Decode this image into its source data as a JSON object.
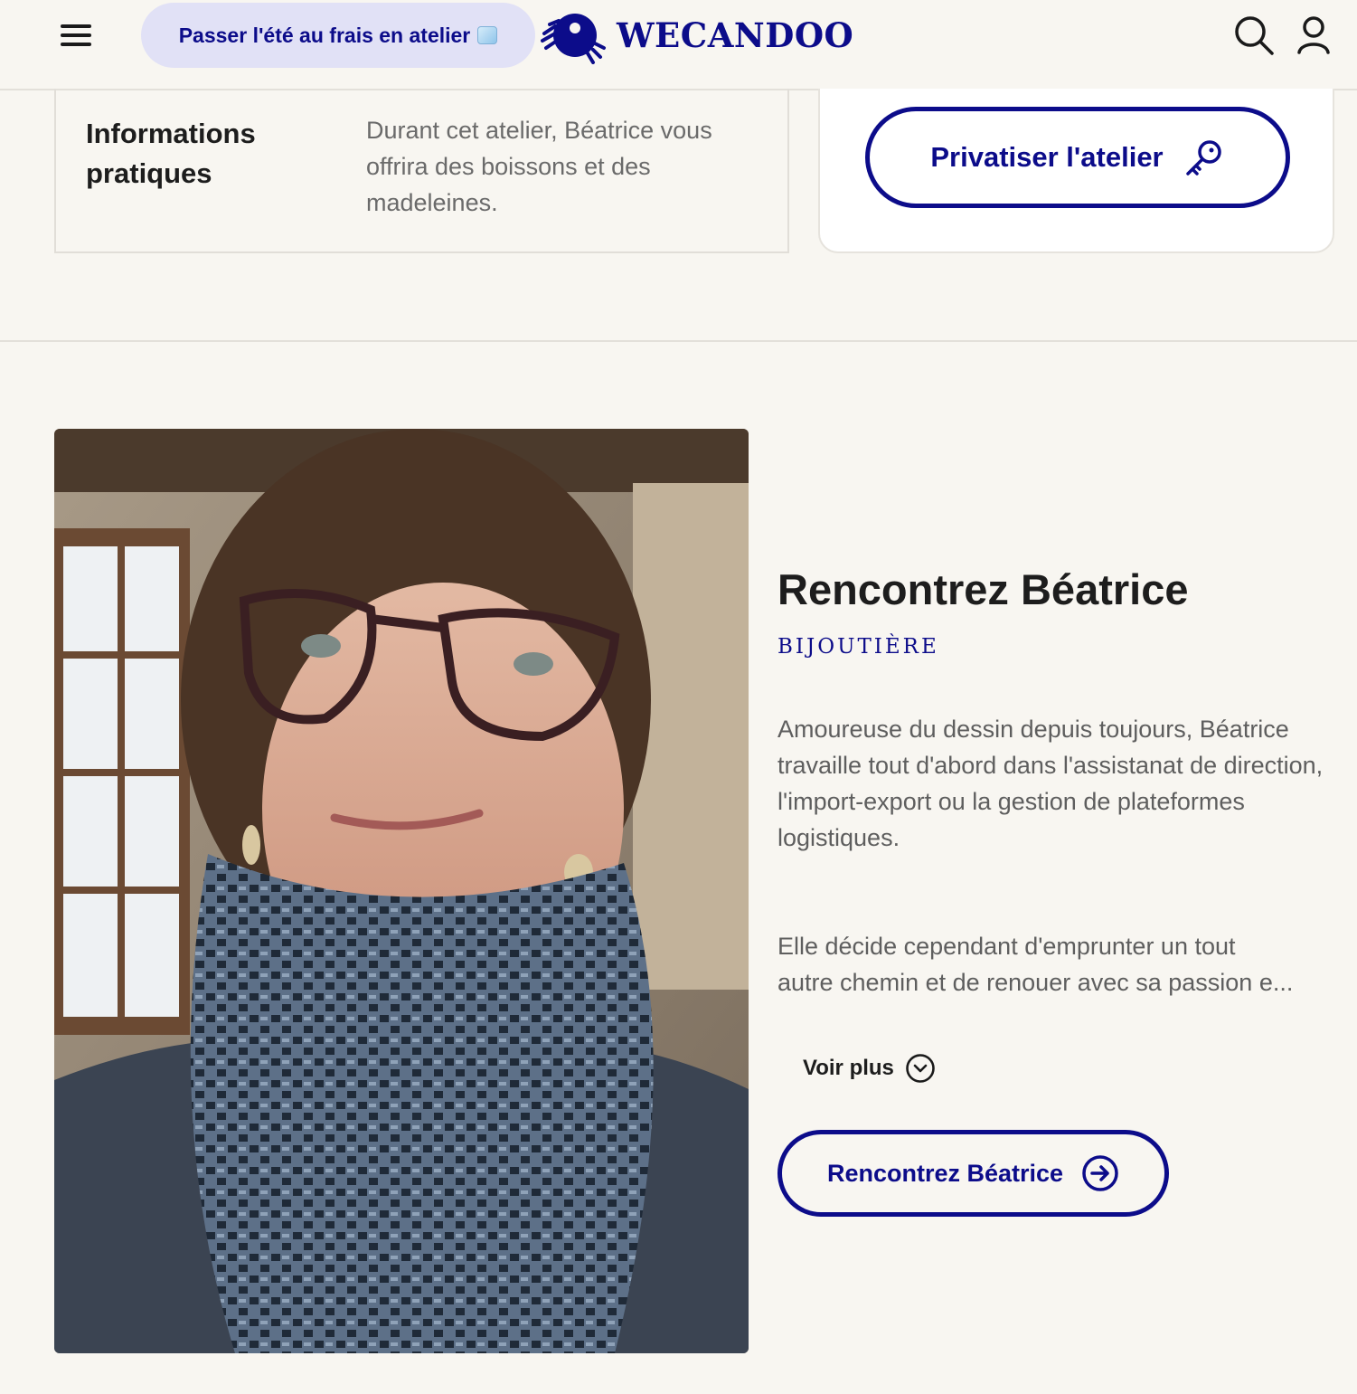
{
  "header": {
    "menu_icon": "hamburger-menu-icon",
    "promo_label": "Passer l'été au frais en atelier",
    "promo_icon": "ice-cube-icon",
    "logo_text": "WECANDOO",
    "search_icon": "search-icon",
    "account_icon": "user-icon",
    "brand_color": "#0c0c8a"
  },
  "info": {
    "title": "Informations pratiques",
    "text": "Durant cet atelier, Béatrice vous offrira des boissons et des madeleines."
  },
  "privatize": {
    "label": "Privatiser l'atelier",
    "icon": "key-icon"
  },
  "artisan": {
    "photo_icon": "artisan-portrait-photo",
    "name_heading": "Rencontrez Béatrice",
    "role": "BIJOUTIÈRE",
    "bio_paragraph_1": "Amoureuse du dessin depuis toujours, Béatrice travaille tout d'abord dans l'assistanat de direction, l'import-export ou la gestion de plateformes logistiques.",
    "bio_paragraph_2_line1": "Elle décide cependant d'emprunter un tout",
    "bio_paragraph_2_line2": "autre chemin et de renouer avec sa passion e...",
    "voir_plus_label": "Voir plus",
    "voir_plus_icon": "chevron-down-circle-icon",
    "meet_button_label": "Rencontrez Béatrice",
    "meet_button_icon": "arrow-right-circle-icon"
  },
  "colors": {
    "background": "#f8f6f1",
    "accent": "#0c0c8a",
    "promo_background": "#e1e1f6"
  }
}
